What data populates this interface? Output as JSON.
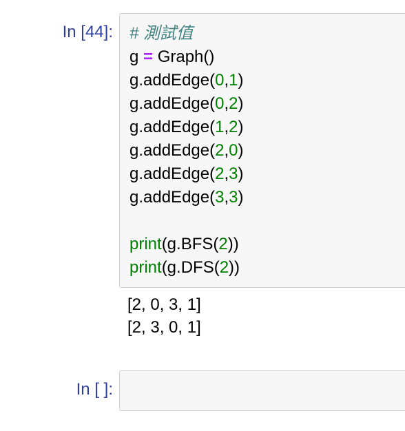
{
  "cells": [
    {
      "prompt": "In [44]:",
      "code_lines": [
        [
          {
            "t": "comment",
            "v": "# 測試值"
          }
        ],
        [
          {
            "t": "plain",
            "v": "g "
          },
          {
            "t": "op",
            "v": "="
          },
          {
            "t": "plain",
            "v": " Graph()"
          }
        ],
        [
          {
            "t": "plain",
            "v": "g.addEdge("
          },
          {
            "t": "num",
            "v": "0"
          },
          {
            "t": "plain",
            "v": ","
          },
          {
            "t": "num",
            "v": "1"
          },
          {
            "t": "plain",
            "v": ")"
          }
        ],
        [
          {
            "t": "plain",
            "v": "g.addEdge("
          },
          {
            "t": "num",
            "v": "0"
          },
          {
            "t": "plain",
            "v": ","
          },
          {
            "t": "num",
            "v": "2"
          },
          {
            "t": "plain",
            "v": ")"
          }
        ],
        [
          {
            "t": "plain",
            "v": "g.addEdge("
          },
          {
            "t": "num",
            "v": "1"
          },
          {
            "t": "plain",
            "v": ","
          },
          {
            "t": "num",
            "v": "2"
          },
          {
            "t": "plain",
            "v": ")"
          }
        ],
        [
          {
            "t": "plain",
            "v": "g.addEdge("
          },
          {
            "t": "num",
            "v": "2"
          },
          {
            "t": "plain",
            "v": ","
          },
          {
            "t": "num",
            "v": "0"
          },
          {
            "t": "plain",
            "v": ")"
          }
        ],
        [
          {
            "t": "plain",
            "v": "g.addEdge("
          },
          {
            "t": "num",
            "v": "2"
          },
          {
            "t": "plain",
            "v": ","
          },
          {
            "t": "num",
            "v": "3"
          },
          {
            "t": "plain",
            "v": ")"
          }
        ],
        [
          {
            "t": "plain",
            "v": "g.addEdge("
          },
          {
            "t": "num",
            "v": "3"
          },
          {
            "t": "plain",
            "v": ","
          },
          {
            "t": "num",
            "v": "3"
          },
          {
            "t": "plain",
            "v": ")"
          }
        ],
        [],
        [
          {
            "t": "builtin",
            "v": "print"
          },
          {
            "t": "plain",
            "v": "(g.BFS("
          },
          {
            "t": "num",
            "v": "2"
          },
          {
            "t": "plain",
            "v": "))"
          }
        ],
        [
          {
            "t": "builtin",
            "v": "print"
          },
          {
            "t": "plain",
            "v": "(g.DFS("
          },
          {
            "t": "num",
            "v": "2"
          },
          {
            "t": "plain",
            "v": "))"
          }
        ]
      ],
      "output_lines": [
        "[2, 0, 3, 1]",
        "[2, 3, 0, 1]"
      ]
    },
    {
      "prompt": "In [ ]:",
      "code_lines": [],
      "output_lines": []
    }
  ],
  "colors": {
    "prompt": "#303F9F",
    "comment": "#408080",
    "operator": "#AA22FF",
    "number": "#008000",
    "builtin": "#008000",
    "cell_bg": "#f7f7f7",
    "cell_border": "#cfcfcf"
  }
}
